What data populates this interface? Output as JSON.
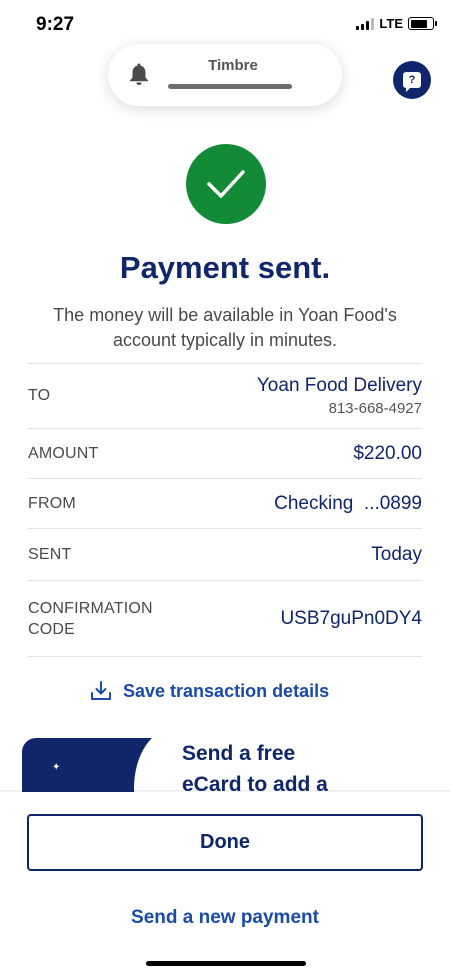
{
  "status_bar": {
    "time": "9:27",
    "network": "LTE"
  },
  "doorbell": {
    "icon": "bell-icon",
    "label": "Timbre"
  },
  "help": {
    "icon": "help-chat-icon",
    "glyph": "?"
  },
  "confirmation": {
    "icon": "checkmark-icon",
    "title": "Payment sent.",
    "message": "The money will be available in Yoan Food's account typically in minutes."
  },
  "details": {
    "to_label": "TO",
    "to_name": "Yoan Food Delivery",
    "to_phone": "813-668-4927",
    "amount_label": "AMOUNT",
    "amount_value": "$220.00",
    "from_label": "FROM",
    "from_value": "Checking  ...0899",
    "sent_label": "SENT",
    "sent_value": "Today",
    "confirmation_label": "CONFIRMATION CODE",
    "confirmation_value": "USB7guPn0DY4"
  },
  "save_link": {
    "icon": "download-icon",
    "label": "Save transaction details"
  },
  "promo": {
    "line1": "Send a free",
    "line2": "eCard to add a"
  },
  "actions": {
    "done_label": "Done",
    "new_payment_label": "Send a new payment"
  },
  "colors": {
    "brand_navy": "#10266b",
    "success_green": "#138a36",
    "link_blue": "#1a4ba8"
  }
}
